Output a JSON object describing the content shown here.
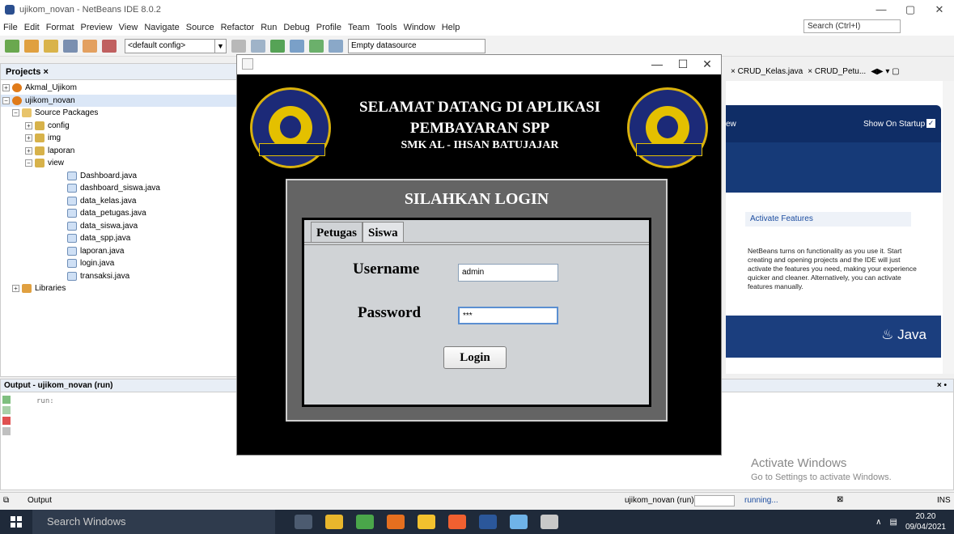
{
  "ide": {
    "window_title": "ujikom_novan - NetBeans IDE 8.0.2",
    "search_placeholder": "Search (Ctrl+I)",
    "menu": [
      "File",
      "Edit",
      "Format",
      "Preview",
      "View",
      "Navigate",
      "Source",
      "Refactor",
      "Run",
      "Debug",
      "Profile",
      "Team",
      "Tools",
      "Window",
      "Help"
    ],
    "config_select": "<default config>",
    "datasource_select": "Empty datasource"
  },
  "projects": {
    "tab_label": "Projects ×",
    "nodes": [
      "Akmal_Ujikom",
      "ujikom_novan",
      "Source Packages",
      "config",
      "img",
      "laporan",
      "view",
      "Dashboard.java",
      "dashboard_siswa.java",
      "data_kelas.java",
      "data_petugas.java",
      "data_siswa.java",
      "data_spp.java",
      "laporan.java",
      "login.java",
      "transaksi.java",
      "Libraries"
    ]
  },
  "editor": {
    "tabs": [
      "CRUD_Kelas.java",
      "CRUD_Petu..."
    ],
    "startpage_ew": "ew",
    "show_on_startup": "Show On Startup",
    "activate_features": "Activate Features",
    "activate_text": "NetBeans turns on functionality as you use it. Start creating and opening projects and the IDE will just activate the features you need, making your experience quicker and cleaner. Alternatively, you can activate features manually.",
    "java_brand": "Java"
  },
  "output": {
    "title": "Output - ujikom_novan (run)",
    "text": "run:",
    "close": "× •"
  },
  "watermark": {
    "line1": "Activate Windows",
    "line2": "Go to Settings to activate Windows."
  },
  "status": {
    "output_tab": "Output",
    "run_label": "ujikom_novan (run)",
    "running": "running...",
    "ins": "INS"
  },
  "taskbar": {
    "search": "Search Windows",
    "time": "20.20",
    "date": "09/04/2021"
  },
  "app": {
    "heading1": "SELAMAT DATANG DI APLIKASI",
    "heading2": "PEMBAYARAN SPP",
    "heading3": "SMK AL - IHSAN BATUJAJAR",
    "login_title": "SILAHKAN LOGIN",
    "tab_petugas": "Petugas",
    "tab_siswa": "Siswa",
    "username_label": "Username",
    "username_value": "admin",
    "password_label": "Password",
    "password_value": "***",
    "login_button": "Login"
  }
}
